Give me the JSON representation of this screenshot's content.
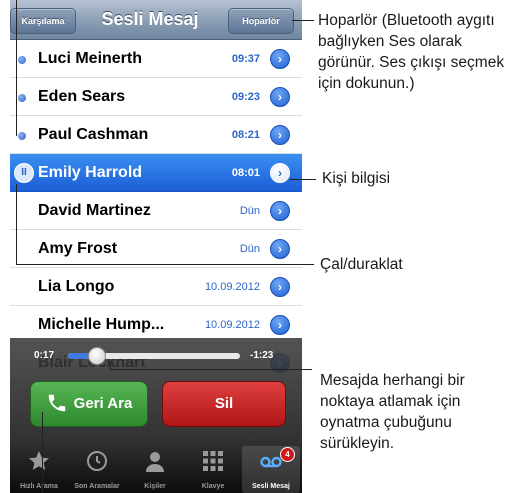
{
  "nav": {
    "left_button": "Karşılama",
    "title": "Sesli Mesaj",
    "right_button": "Hoparlör"
  },
  "messages": [
    {
      "name": "Luci Meinerth",
      "time": "09:37",
      "unread": true
    },
    {
      "name": "Eden Sears",
      "time": "09:23",
      "unread": true
    },
    {
      "name": "Paul Cashman",
      "time": "08:21",
      "unread": true
    },
    {
      "name": "Emily Harrold",
      "time": "08:01",
      "selected": true
    },
    {
      "name": "David Martinez",
      "time": "Dün"
    },
    {
      "name": "Amy Frost",
      "time": "Dün"
    },
    {
      "name": "Lia Longo",
      "time": "10.09.2012"
    },
    {
      "name": "Michelle Hump...",
      "time": "10.09.2012"
    },
    {
      "name": "Blair Lockhart",
      "time": ""
    }
  ],
  "player": {
    "elapsed": "0:17",
    "remaining": "-1:23",
    "progress": 0.17
  },
  "buttons": {
    "callback": "Geri Ara",
    "delete": "Sil"
  },
  "tabs": [
    {
      "label": "Hızlı Arama",
      "icon": "star-icon"
    },
    {
      "label": "Son Aramalar",
      "icon": "clock-icon"
    },
    {
      "label": "Kişiler",
      "icon": "person-icon"
    },
    {
      "label": "Klavye",
      "icon": "keypad-icon"
    },
    {
      "label": "Sesli Mesaj",
      "icon": "voicemail-icon",
      "active": true,
      "badge": "4"
    }
  ],
  "callouts": {
    "speaker": "Hoparlör (Bluetooth aygıtı bağlıyken Ses olarak görünür. Ses çıkışı seçmek için dokunun.)",
    "contact_info": "Kişi bilgisi",
    "play_pause": "Çal/duraklat",
    "scrub": "Mesajda herhangi bir noktaya atlamak için oynatma çubuğunu sürükleyin."
  },
  "colors": {
    "accent": "#2a66d0",
    "callback_green": "#3c9a3a",
    "delete_red": "#c81e1e"
  }
}
